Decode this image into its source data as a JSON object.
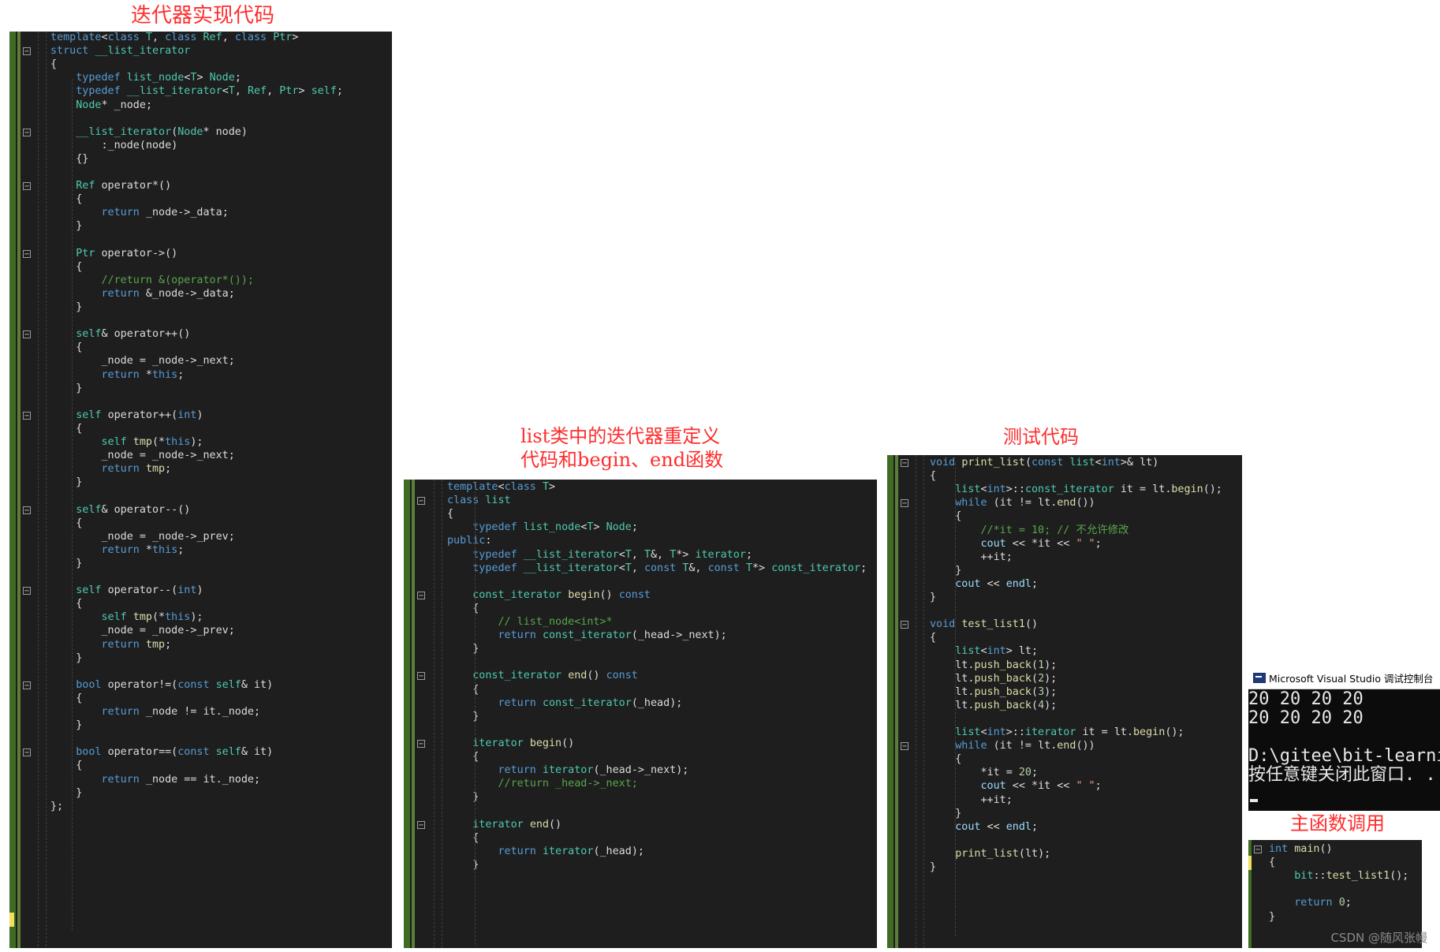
{
  "captions": {
    "iterator_impl": "迭代器实现代码",
    "list_iterator_redef": "list类中的迭代器重定义\n代码和begin、end函数",
    "test_code": "测试代码",
    "main_call": "主函数调用"
  },
  "panel_iterator": {
    "lines": [
      "template<class T, class Ref, class Ptr>",
      "struct __list_iterator",
      "{",
      "    typedef list_node<T> Node;",
      "    typedef __list_iterator<T, Ref, Ptr> self;",
      "    Node* _node;",
      "",
      "    __list_iterator(Node* node)",
      "        :_node(node)",
      "    {}",
      "",
      "    Ref operator*()",
      "    {",
      "        return _node->_data;",
      "    }",
      "",
      "    Ptr operator->()",
      "    {",
      "        //return &(operator*());",
      "        return &_node->_data;",
      "    }",
      "",
      "    self& operator++()",
      "    {",
      "        _node = _node->_next;",
      "        return *this;",
      "    }",
      "",
      "    self operator++(int)",
      "    {",
      "        self tmp(*this);",
      "        _node = _node->_next;",
      "        return tmp;",
      "    }",
      "",
      "    self& operator--()",
      "    {",
      "        _node = _node->_prev;",
      "        return *this;",
      "    }",
      "",
      "    self operator--(int)",
      "    {",
      "        self tmp(*this);",
      "        _node = _node->_prev;",
      "        return tmp;",
      "    }",
      "",
      "    bool operator!=(const self& it)",
      "    {",
      "        return _node != it._node;",
      "    }",
      "",
      "    bool operator==(const self& it)",
      "    {",
      "        return _node == it._node;",
      "    }",
      "};"
    ]
  },
  "panel_list": {
    "lines": [
      "template<class T>",
      "class list",
      "{",
      "    typedef list_node<T> Node;",
      "public:",
      "    typedef __list_iterator<T, T&, T*> iterator;",
      "    typedef __list_iterator<T, const T&, const T*> const_iterator;",
      "",
      "    const_iterator begin() const",
      "    {",
      "        // list_node<int>*",
      "        return const_iterator(_head->_next);",
      "    }",
      "",
      "    const_iterator end() const",
      "    {",
      "        return const_iterator(_head);",
      "    }",
      "",
      "    iterator begin()",
      "    {",
      "        return iterator(_head->_next);",
      "        //return _head->_next;",
      "    }",
      "",
      "    iterator end()",
      "    {",
      "        return iterator(_head);",
      "    }"
    ]
  },
  "panel_test": {
    "lines": [
      "void print_list(const list<int>& lt)",
      "{",
      "    list<int>::const_iterator it = lt.begin();",
      "    while (it != lt.end())",
      "    {",
      "        //*it = 10; // 不允许修改",
      "        cout << *it << \" \";",
      "        ++it;",
      "    }",
      "    cout << endl;",
      "}",
      "",
      "void test_list1()",
      "{",
      "    list<int> lt;",
      "    lt.push_back(1);",
      "    lt.push_back(2);",
      "    lt.push_back(3);",
      "    lt.push_back(4);",
      "",
      "    list<int>::iterator it = lt.begin();",
      "    while (it != lt.end())",
      "    {",
      "        *it = 20;",
      "        cout << *it << \" \";",
      "        ++it;",
      "    }",
      "    cout << endl;",
      "",
      "    print_list(lt);",
      "}"
    ]
  },
  "console": {
    "title": "Microsoft Visual Studio 调试控制台",
    "output": "20 20 20 20\n20 20 20 20\n\nD:\\gitee\\bit-learning\n按任意键关闭此窗口. . ."
  },
  "panel_main": {
    "lines": [
      "int main()",
      "{",
      "    bit::test_list1();",
      "",
      "    return 0;",
      "}"
    ]
  },
  "watermark": "CSDN @随风张幔",
  "colors": {
    "keyword": "#569cd6",
    "type": "#4ec9b0",
    "function": "#dcdcaa",
    "identifier": "#9cdcfe",
    "comment": "#57a64a",
    "string": "#d69d85",
    "number": "#b5cea8",
    "editor_bg": "#1e1e1e",
    "caption_red": "#ff2d2d"
  }
}
